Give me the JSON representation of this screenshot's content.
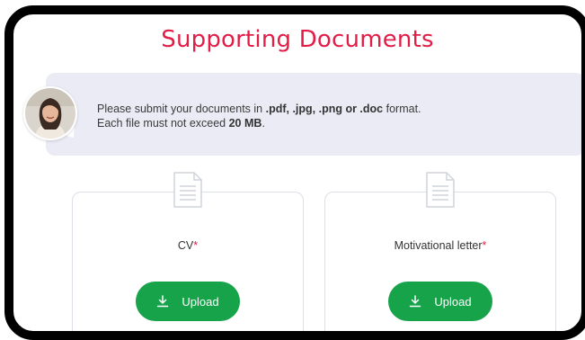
{
  "page": {
    "title": "Supporting Documents"
  },
  "notice": {
    "line1_prefix": "Please submit your documents in ",
    "line1_formats": ".pdf, .jpg, .png or .doc",
    "line1_suffix": " format.",
    "line2_prefix": "Each file must not exceed ",
    "line2_size": "20 MB",
    "line2_suffix": "."
  },
  "cards": [
    {
      "label": "CV",
      "required_mark": "*",
      "button_label": "Upload",
      "icon": "document-icon",
      "button_icon": "download-icon"
    },
    {
      "label": "Motivational letter",
      "required_mark": "*",
      "button_label": "Upload",
      "icon": "document-icon",
      "button_icon": "download-icon"
    }
  ],
  "colors": {
    "title": "#e11d48",
    "required": "#e11d48",
    "button": "#16a34a",
    "notice_bg": "#ebebf5",
    "frame": "#000000"
  }
}
